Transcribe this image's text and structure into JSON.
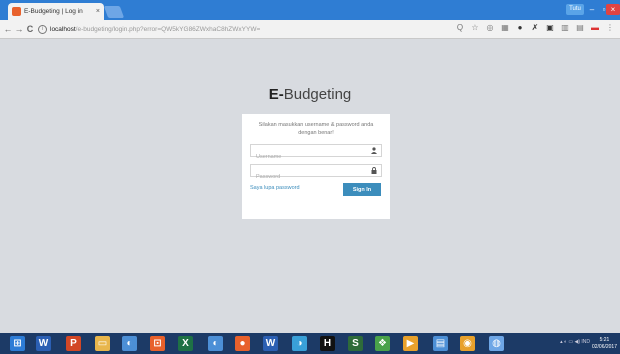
{
  "browser": {
    "tab_title": "E-Budgeting | Log in",
    "tab_close": "×",
    "user_badge": "Tutu",
    "url_host": "localhost",
    "url_path": "/e-budgeting/login.php?error=QW5kYG86ZWxhaC8hZWxYYW=",
    "nav": {
      "back": "←",
      "forward": "→",
      "reload": "C"
    },
    "extensions": [
      "Q",
      "☆",
      "◎",
      "▦",
      "●",
      "✗",
      "▣",
      "▥",
      "▤",
      "▬",
      "⋮"
    ]
  },
  "page": {
    "brand_bold": "E-",
    "brand_rest": "Budgeting",
    "login_message": "Silakan masukkan username & password anda dengan benar!",
    "username_placeholder": "Username",
    "password_placeholder": "Password",
    "forgot_password": "Saya lupa password",
    "signin_label": "Sign In",
    "user_icon": "user-icon",
    "lock_icon": "lock-icon"
  },
  "taskbar": {
    "items": [
      {
        "label": "⊞",
        "color": "#2d7cd6"
      },
      {
        "label": "W",
        "color": "#2b5fb3"
      },
      {
        "label": "P",
        "color": "#d24726"
      },
      {
        "label": "▭",
        "color": "#e8b64c"
      },
      {
        "label": "◐",
        "color": "#4c8fd6"
      },
      {
        "label": "⊡",
        "color": "#e8612c"
      },
      {
        "label": "X",
        "color": "#1e7145"
      },
      {
        "label": "◐",
        "color": "#4c8fd6"
      },
      {
        "label": "●",
        "color": "#e8612c"
      },
      {
        "label": "W",
        "color": "#2b5fb3"
      },
      {
        "label": "◑",
        "color": "#39a0d8"
      },
      {
        "label": "H",
        "color": "#111111"
      },
      {
        "label": "S",
        "color": "#2e6b3a"
      },
      {
        "label": "❖",
        "color": "#4aa24a"
      },
      {
        "label": "▶",
        "color": "#e8a12c"
      },
      {
        "label": "▤",
        "color": "#4c8fd6"
      },
      {
        "label": "◉",
        "color": "#e8a12c"
      },
      {
        "label": "◍",
        "color": "#6ea6e6"
      }
    ],
    "tray": "▴  ◐  ▭  ◀)  IND",
    "time": "5:21",
    "date": "02/06/2017"
  }
}
